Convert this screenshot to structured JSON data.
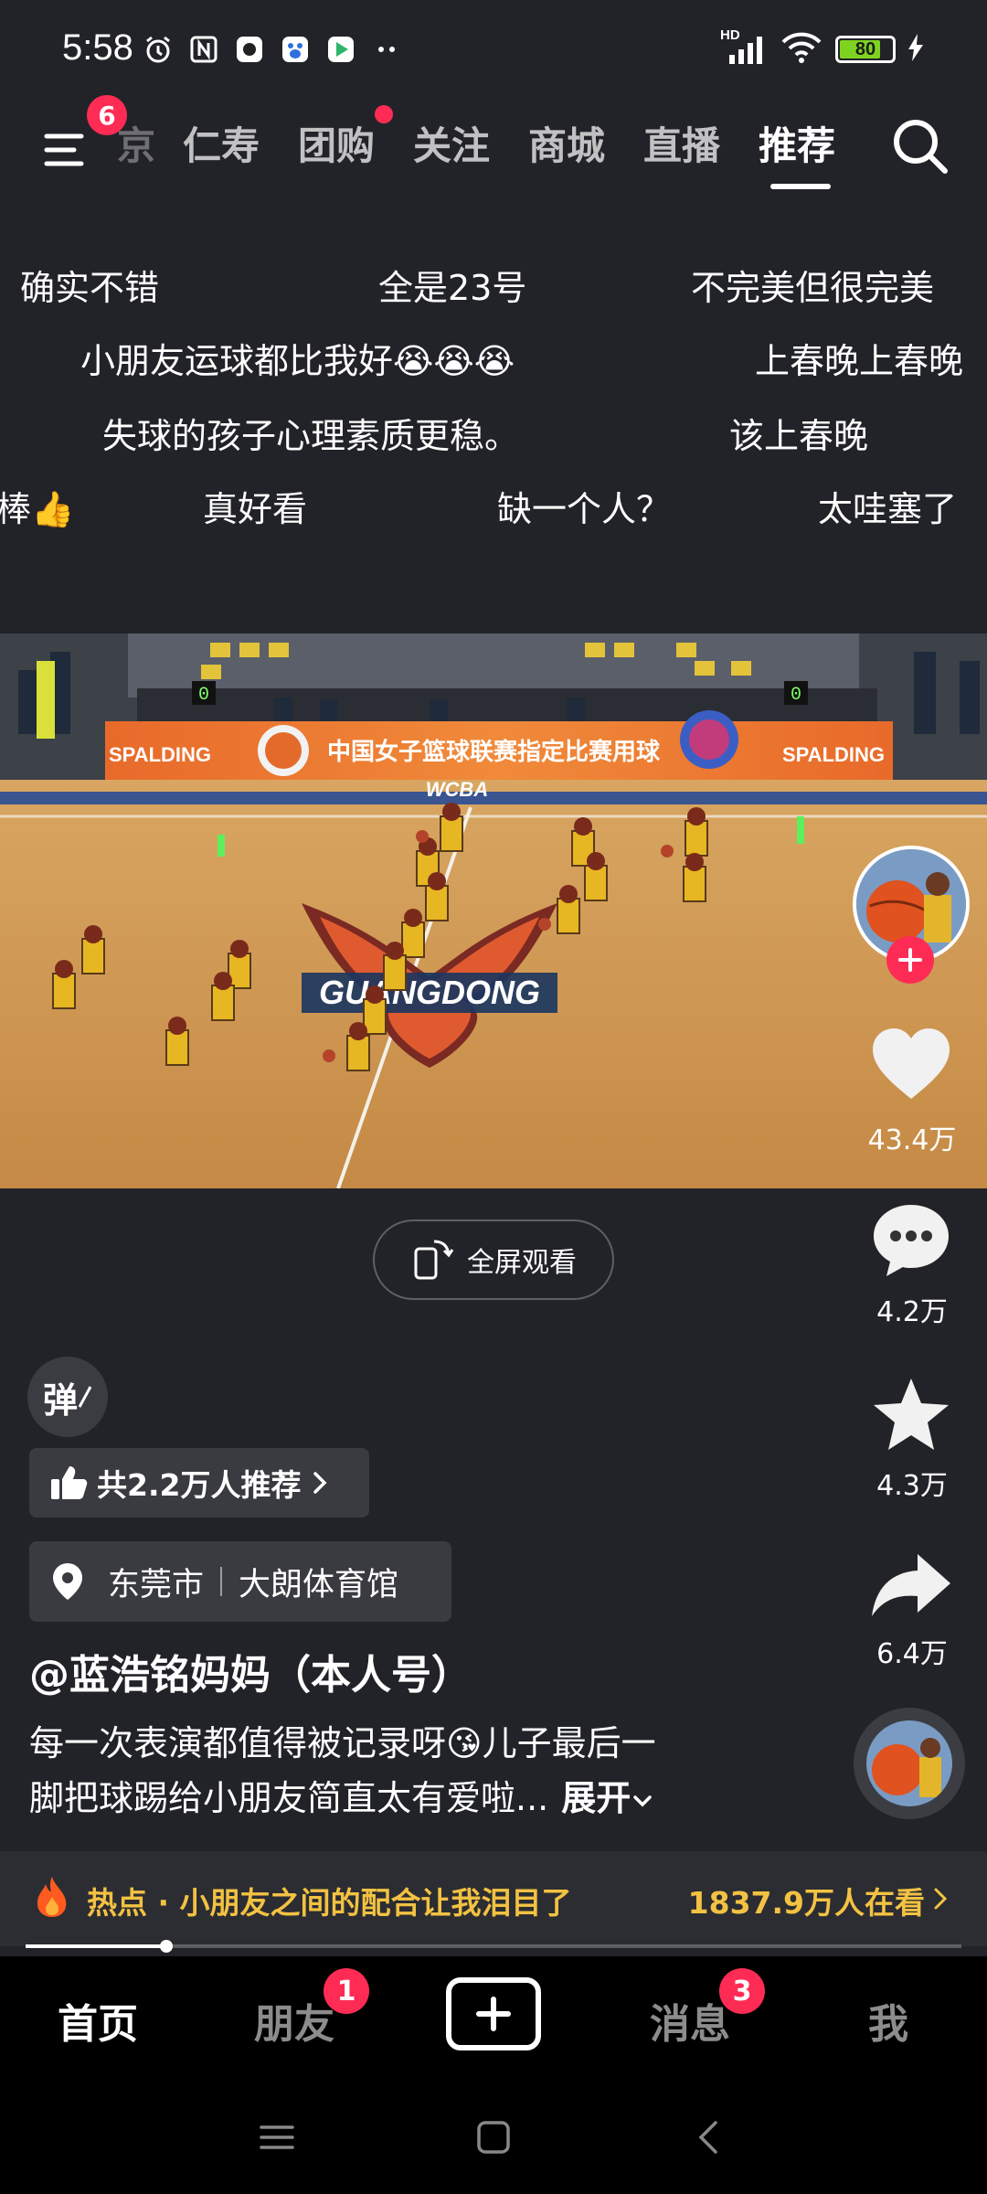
{
  "status_bar": {
    "time": "5:58",
    "network": "HD",
    "battery": "80",
    "battery_level": 0.8
  },
  "top_nav": {
    "menu_badge": "6",
    "tabs": [
      {
        "label": "京",
        "partial": true
      },
      {
        "label": "仁寿"
      },
      {
        "label": "团购",
        "dot": true
      },
      {
        "label": "关注"
      },
      {
        "label": "商城"
      },
      {
        "label": "直播"
      },
      {
        "label": "推荐",
        "active": true
      }
    ]
  },
  "danmaku": [
    "确实不错",
    "全是23号",
    "不完美但很完美",
    "小朋友运球都比我好😭😭😭",
    "上春晚上春晚",
    "失球的孩子心理素质更稳。",
    "该上春晚",
    "棒👍",
    "真好看",
    "缺一个人？",
    "太哇塞了"
  ],
  "video": {
    "banner_text": "中国女子篮球联赛指定比赛用球",
    "brand": "SPALDING",
    "league": "WCBA",
    "court_logo": "GUANGDONG",
    "score_left": "0",
    "score_right": "0"
  },
  "rail": {
    "likes": "43.4万",
    "comments": "4.2万",
    "favorites": "4.3万",
    "shares": "6.4万"
  },
  "fullscreen_label": "全屏观看",
  "danmaku_toggle_label": "弹",
  "recommend_label": "共2.2万人推荐",
  "location": {
    "city": "东莞市",
    "venue": "大朗体育馆"
  },
  "author": "@蓝浩铭妈妈（本人号）",
  "description": {
    "line1": "每一次表演都值得被记录呀😘儿子最后一",
    "line2": "脚把球踢给小朋友简直太有爱啦...",
    "expand": "展开"
  },
  "hot": {
    "label": "热点 · 小朋友之间的配合让我泪目了",
    "viewers": "1837.9万人在看"
  },
  "progress": 0.15,
  "bottom_tabs": {
    "home": "首页",
    "friends": "朋友",
    "friends_badge": "1",
    "messages": "消息",
    "messages_badge": "3",
    "me": "我"
  },
  "colors": {
    "accent_red": "#fe2c55",
    "hot_yellow": "#f3c242",
    "background": "#222328"
  }
}
